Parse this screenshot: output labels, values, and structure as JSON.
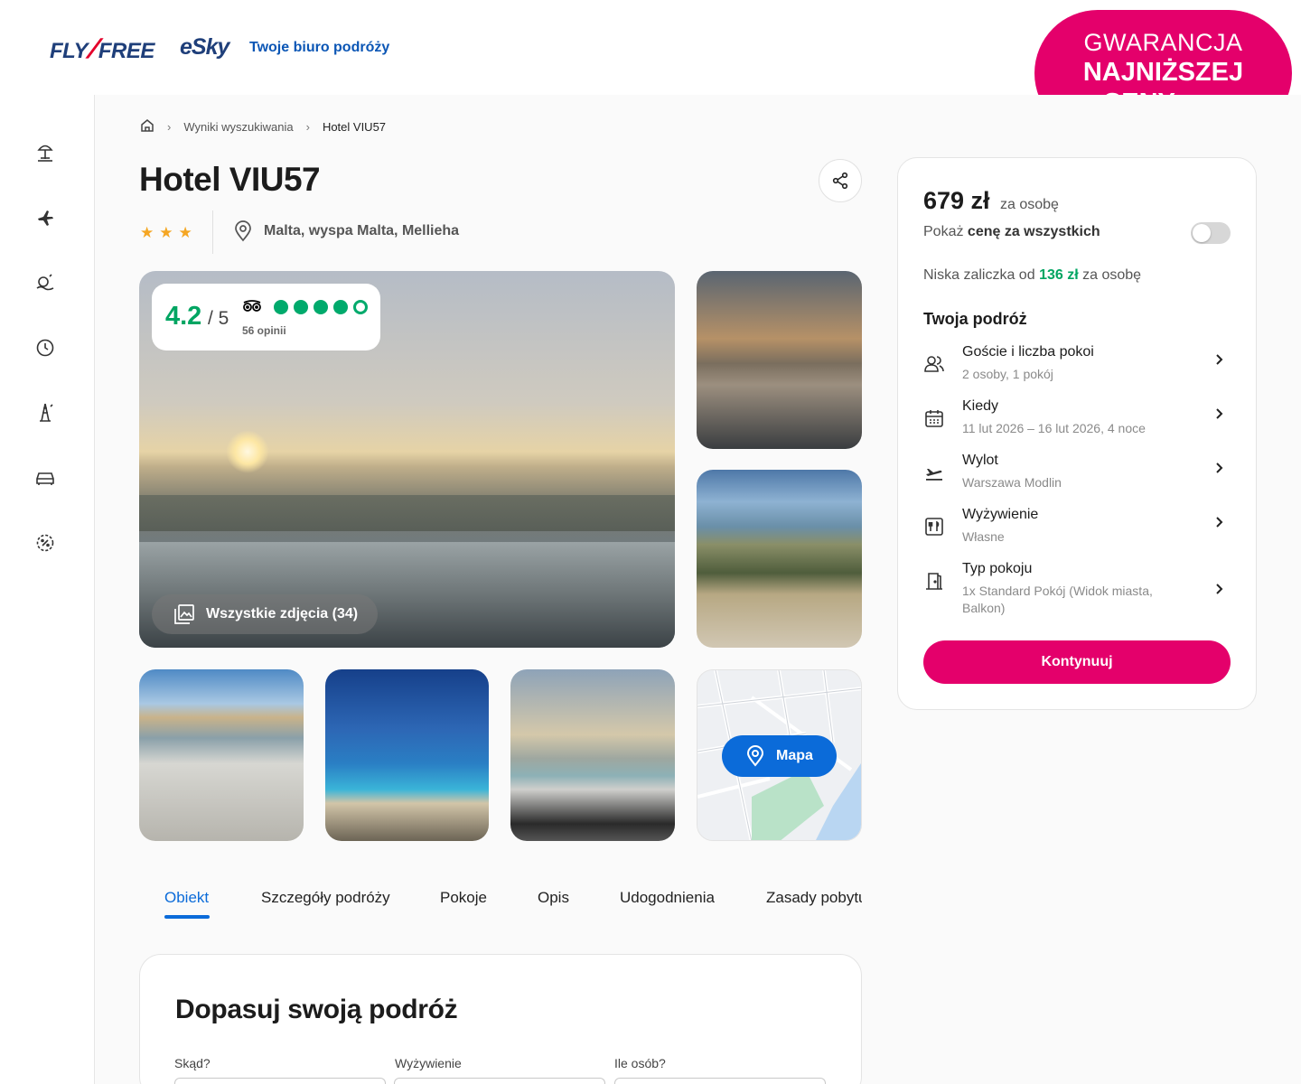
{
  "header": {
    "logo_fly": "FLY",
    "logo_free": "FREE",
    "logo_esky": "eSky",
    "tagline": "Twoje biuro podróży"
  },
  "badge": {
    "line1": "GWARANCJA",
    "line2": "NAJNIŻSZEJ",
    "line3": "CENY",
    "icon": "plane-plus-hotel-icon"
  },
  "sidebar": {
    "items": [
      {
        "name": "beach-umbrella-icon"
      },
      {
        "name": "plane-icon"
      },
      {
        "name": "sun-wave-icon"
      },
      {
        "name": "clock-icon"
      },
      {
        "name": "eiffel-tower-icon"
      },
      {
        "name": "car-icon"
      },
      {
        "name": "discount-badge-icon"
      }
    ]
  },
  "breadcrumb": {
    "home_icon": "home-icon",
    "items": [
      "Wyniki wyszukiwania",
      "Hotel VIU57"
    ]
  },
  "hotel": {
    "name": "Hotel VIU57",
    "stars": 3,
    "location": "Malta, wyspa Malta, Mellieha"
  },
  "rating": {
    "score": "4.2",
    "scale": "/ 5",
    "reviews": "56 opinii",
    "dots_filled": 4,
    "dots_total": 5
  },
  "gallery": {
    "all_photos_label": "Wszystkie zdjęcia (34)",
    "map_label": "Mapa"
  },
  "tabs": [
    {
      "label": "Obiekt",
      "active": true
    },
    {
      "label": "Szczegóły podróży",
      "active": false
    },
    {
      "label": "Pokoje",
      "active": false
    },
    {
      "label": "Opis",
      "active": false
    },
    {
      "label": "Udogodnienia",
      "active": false
    },
    {
      "label": "Zasady pobytu",
      "active": false
    }
  ],
  "customize": {
    "title": "Dopasuj swoją podróż",
    "fields": [
      {
        "label": "Skąd?"
      },
      {
        "label": "Wyżywienie"
      },
      {
        "label": "Ile osób?"
      }
    ]
  },
  "booking": {
    "price": "679 zł",
    "price_unit": "za osobę",
    "show_all_prefix": "Pokaż",
    "show_all_bold": "cenę za wszystkich",
    "toggle_on": false,
    "deposit_prefix": "Niska zaliczka od",
    "deposit_amount": "136 zł",
    "deposit_suffix": "za osobę",
    "trip_title": "Twoja podróż",
    "rows": [
      {
        "label": "Goście i liczba pokoi",
        "value": "2 osoby, 1 pokój",
        "icon": "guests-icon"
      },
      {
        "label": "Kiedy",
        "value": "11 lut 2026 – 16 lut 2026, 4 noce",
        "icon": "calendar-icon"
      },
      {
        "label": "Wylot",
        "value": "Warszawa Modlin",
        "icon": "takeoff-icon"
      },
      {
        "label": "Wyżywienie",
        "value": "Własne",
        "icon": "meal-icon"
      },
      {
        "label": "Typ pokoju",
        "value": "1x Standard Pokój (Widok miasta, Balkon)",
        "icon": "door-icon"
      }
    ],
    "continue_label": "Kontynuuj"
  },
  "colors": {
    "brand_pink": "#e4006b",
    "brand_blue": "#0b6bd9",
    "rating_green": "#00a562",
    "star": "#f5a623"
  }
}
